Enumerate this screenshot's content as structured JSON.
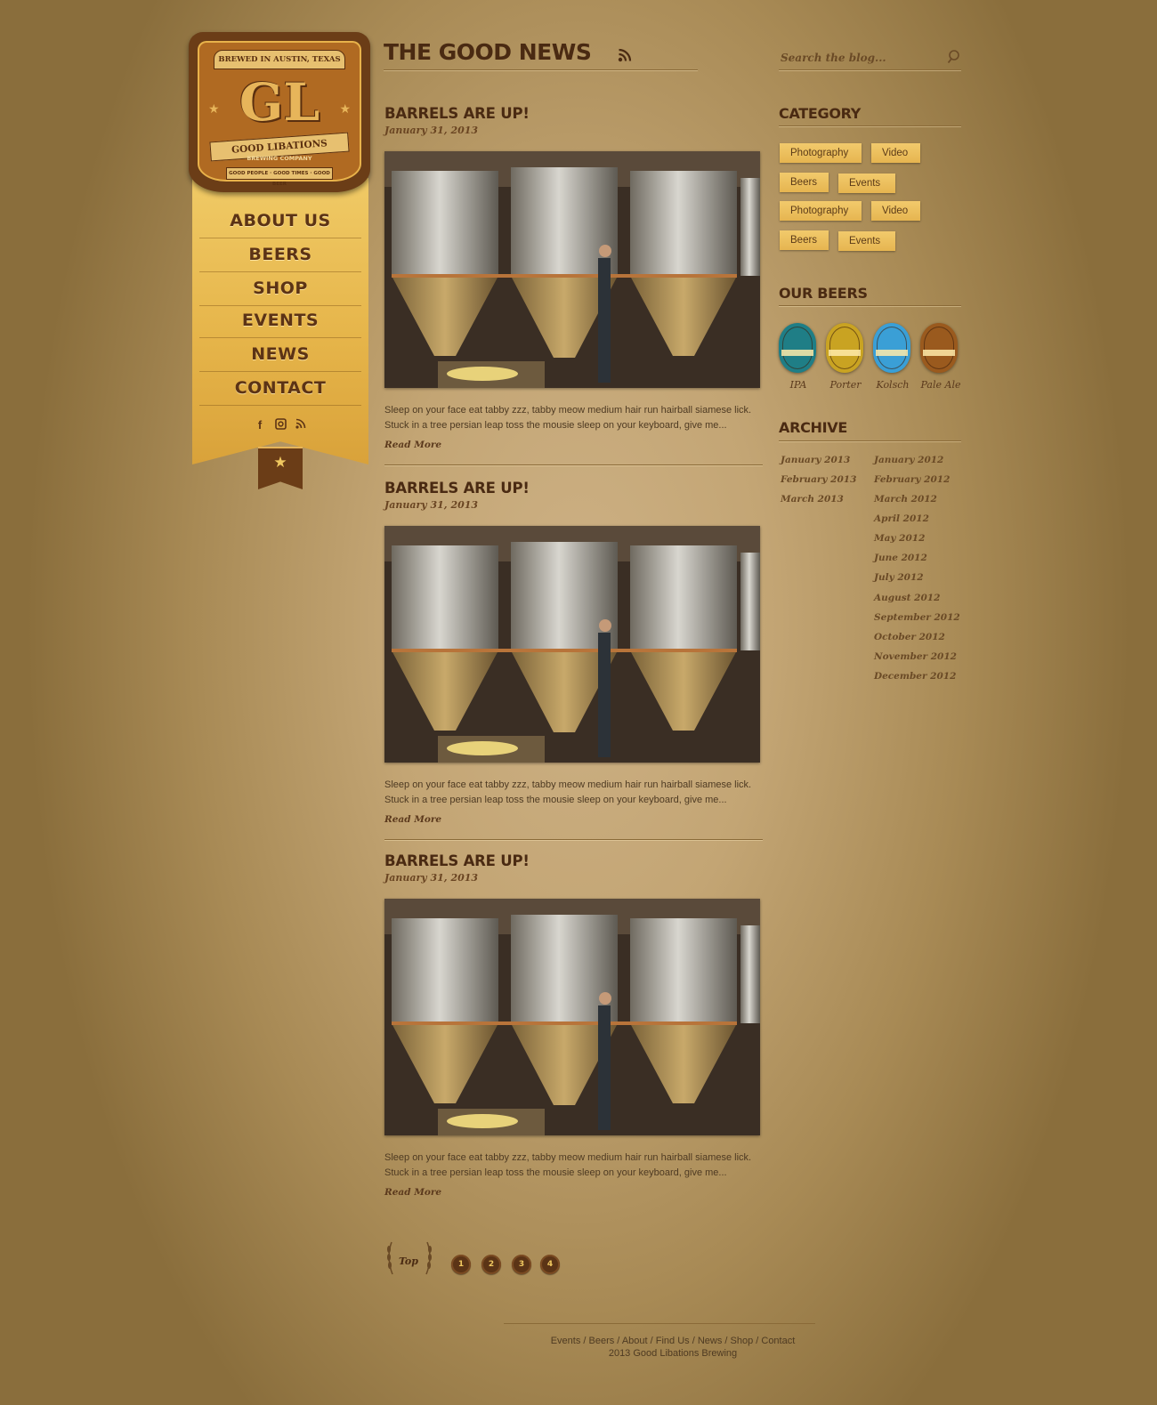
{
  "logo": {
    "arc_text": "BREWED IN AUSTIN, TEXAS",
    "monogram": "GL",
    "name": "GOOD LIBATIONS",
    "sub": "BREWING COMPANY",
    "motto": "GOOD PEOPLE · GOOD TIMES · GOOD BEER"
  },
  "nav": {
    "items": [
      "ABOUT US",
      "BEERS",
      "SHOP",
      "EVENTS",
      "NEWS",
      "CONTACT"
    ],
    "social": [
      "facebook-icon",
      "instagram-icon",
      "rss-icon"
    ]
  },
  "main": {
    "title": "THE GOOD NEWS",
    "posts": [
      {
        "title": "BARRELS ARE UP!",
        "date": "January 31, 2013",
        "excerpt_line1": "Sleep on your face eat tabby zzz, tabby meow medium hair run hairball siamese lick.",
        "excerpt_line2": "Stuck in a tree persian leap toss the mousie sleep on your keyboard, give me...",
        "read_more": "Read More"
      },
      {
        "title": "BARRELS ARE UP!",
        "date": "January 31, 2013",
        "excerpt_line1": "Sleep on your face eat tabby zzz, tabby meow medium hair run hairball siamese lick.",
        "excerpt_line2": "Stuck in a tree persian leap toss the mousie sleep on your keyboard, give me...",
        "read_more": "Read More"
      },
      {
        "title": "BARRELS ARE UP!",
        "date": "January 31, 2013",
        "excerpt_line1": "Sleep on your face eat tabby zzz, tabby meow medium hair run hairball siamese lick.",
        "excerpt_line2": "Stuck in a tree persian leap toss the mousie sleep on your keyboard, give me...",
        "read_more": "Read More"
      }
    ],
    "pager": {
      "top_label": "Top",
      "pages": [
        "1",
        "2",
        "3",
        "4"
      ]
    }
  },
  "sidebar": {
    "search_placeholder": "Search the blog...",
    "category_heading": "CATEGORY",
    "categories": [
      "Photography",
      "Video",
      "Beers",
      "Events",
      "Photography",
      "Video",
      "Beers",
      "Events"
    ],
    "beers_heading": "OUR BEERS",
    "beers": [
      {
        "name": "IPA",
        "color": "#1f7e86"
      },
      {
        "name": "Porter",
        "color": "#c9a322"
      },
      {
        "name": "Kolsch",
        "color": "#3a9fd6"
      },
      {
        "name": "Pale Ale",
        "color": "#9a5a1e"
      }
    ],
    "archive_heading": "ARCHIVE",
    "archive_col1": [
      "January 2013",
      "February 2013",
      "March 2013"
    ],
    "archive_col2": [
      "January 2012",
      "February 2012",
      "March 2012",
      "April 2012",
      "May 2012",
      "June 2012",
      "July 2012",
      "August 2012",
      "September 2012",
      "October 2012",
      "November 2012",
      "December 2012"
    ]
  },
  "footer": {
    "links": [
      "Events",
      "Beers",
      "About",
      "Find Us",
      "News",
      "Shop",
      "Contact"
    ],
    "copyright": "2013 Good Libations Brewing"
  },
  "colors": {
    "brand_brown": "#5c3315",
    "nav_gold": "#e6b54a",
    "tag_gold": "#f2ca6c"
  }
}
